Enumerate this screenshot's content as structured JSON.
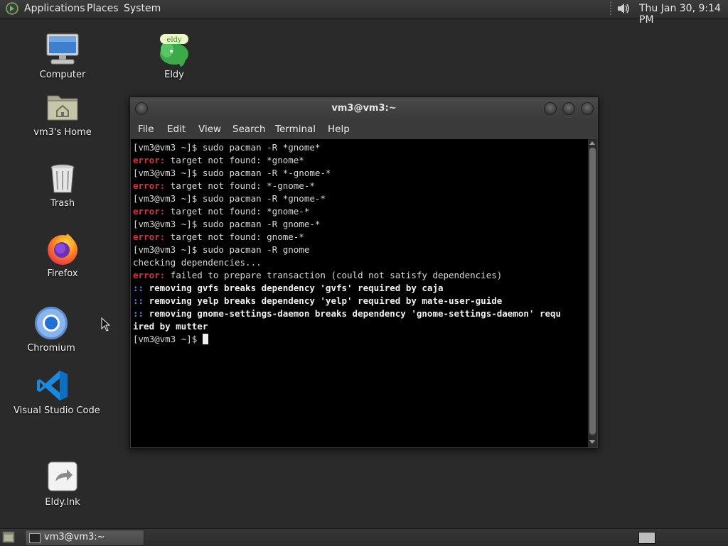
{
  "top_panel": {
    "menus": [
      "Applications",
      "Places",
      "System"
    ],
    "clock": "Thu Jan 30,  9:14 PM"
  },
  "desktop": {
    "icons": [
      {
        "label": "Computer",
        "icon": "computer-icon"
      },
      {
        "label": "Eldy",
        "icon": "eldy-icon"
      },
      {
        "label": "vm3's Home",
        "icon": "home-folder-icon"
      },
      {
        "label": "Trash",
        "icon": "trash-icon"
      },
      {
        "label": "Firefox",
        "icon": "firefox-icon"
      },
      {
        "label": "Chromium",
        "icon": "chromium-icon"
      },
      {
        "label": "Visual Studio Code",
        "icon": "vscode-icon"
      },
      {
        "label": "Eldy.lnk",
        "icon": "shortcut-icon"
      }
    ],
    "eldy_logo_text": "eldy"
  },
  "terminal": {
    "title": "vm3@vm3:~",
    "menu": [
      "File",
      "Edit",
      "View",
      "Search",
      "Terminal",
      "Help"
    ],
    "lines": [
      {
        "text": "[vm3@vm3 ~]$ sudo pacman -R *gnome*"
      },
      {
        "prefix": "error:",
        "text": " target not found: *gnome*"
      },
      {
        "text": "[vm3@vm3 ~]$ sudo pacman -R *-gnome-*"
      },
      {
        "prefix": "error:",
        "text": " target not found: *-gnome-*"
      },
      {
        "text": "[vm3@vm3 ~]$ sudo pacman -R *gnome-*"
      },
      {
        "prefix": "error:",
        "text": " target not found: *gnome-*"
      },
      {
        "text": "[vm3@vm3 ~]$ sudo pacman -R gnome-*"
      },
      {
        "prefix": "error:",
        "text": " target not found: gnome-*"
      },
      {
        "text": "[vm3@vm3 ~]$ sudo pacman -R gnome"
      },
      {
        "text": "checking dependencies..."
      },
      {
        "prefix": "error:",
        "text": " failed to prepare transaction (could not satisfy dependencies)"
      },
      {
        "colons": "::",
        "bold": " removing gvfs breaks dependency 'gvfs' required by caja"
      },
      {
        "colons": "::",
        "bold": " removing yelp breaks dependency 'yelp' required by mate-user-guide"
      },
      {
        "colons": "::",
        "bold": " removing gnome-settings-daemon breaks dependency 'gnome-settings-daemon' requ"
      },
      {
        "bold": "ired by mutter"
      },
      {
        "text": "[vm3@vm3 ~]$ ",
        "cursor": true
      }
    ]
  },
  "taskbar": {
    "window_button": "vm3@vm3:~"
  },
  "colors": {
    "desktop_bg": "#2a2a2a",
    "terminal_bg": "#000000",
    "error_red": "#e0303b",
    "colons_blue": "#5a8cff"
  }
}
